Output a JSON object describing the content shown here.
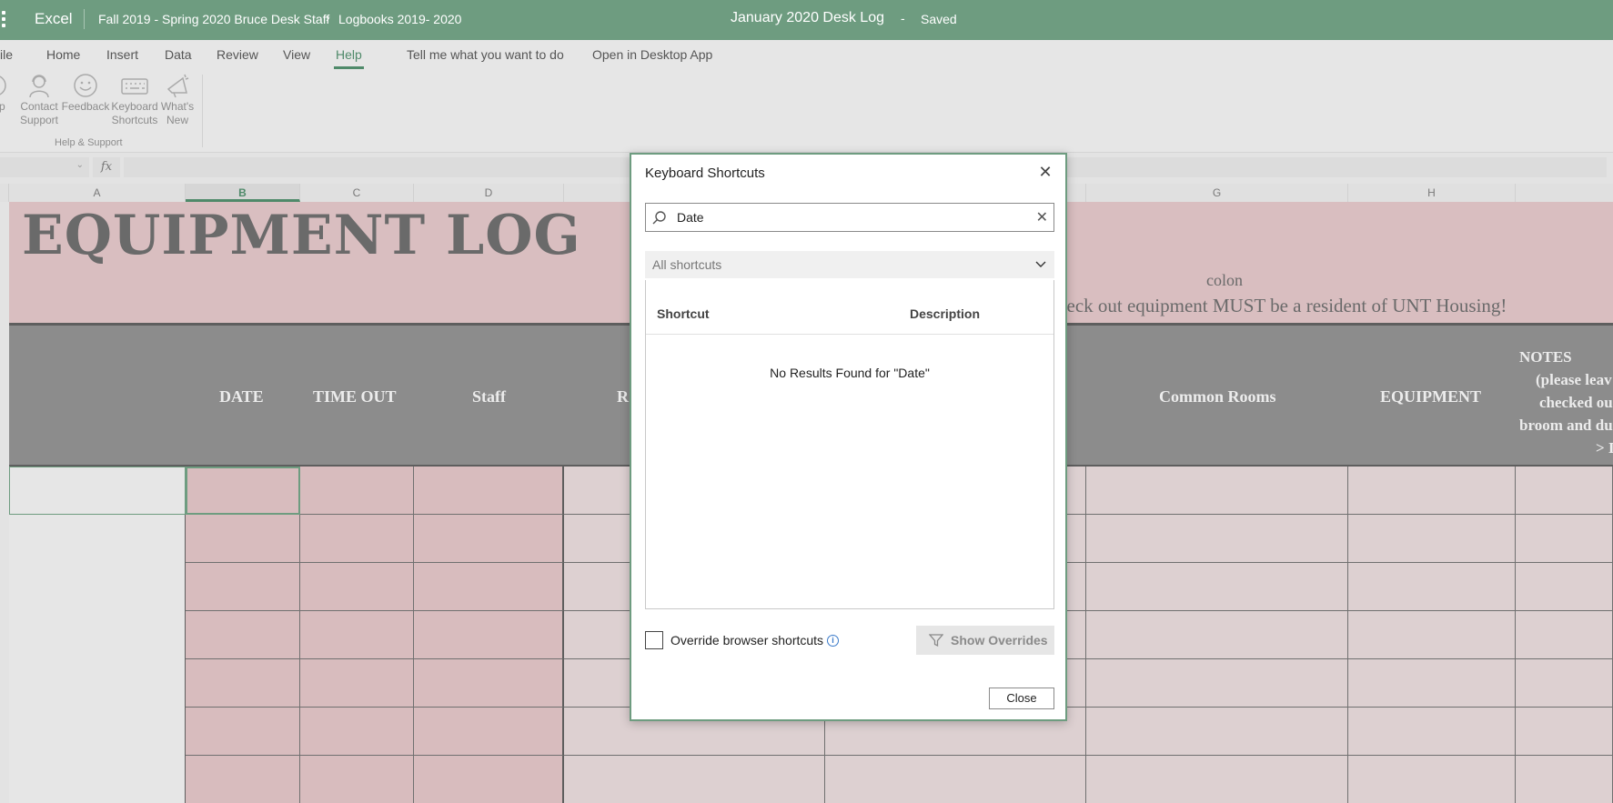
{
  "titlebar": {
    "app_name": "Excel",
    "breadcrumb_folder": "Fall 2019 - Spring 2020 Bruce Desk Staff",
    "breadcrumb_separator": "›",
    "breadcrumb_subfolder": "Logbooks 2019- 2020",
    "document_name": "January 2020 Desk Log",
    "status_separator": "-",
    "status": "Saved",
    "color": "#6e9c80"
  },
  "menu": {
    "tabs": [
      "ile",
      "Home",
      "Insert",
      "Data",
      "Review",
      "View",
      "Help"
    ],
    "active_tab": "Help",
    "tell_me": "Tell me what you want to do",
    "open_desktop": "Open in Desktop App"
  },
  "ribbon": {
    "help_partial": "lp",
    "contact_support": [
      "Contact",
      "Support"
    ],
    "feedback": "Feedback",
    "keyboard_shortcuts": [
      "Keyboard",
      "Shortcuts"
    ],
    "whats_new": [
      "What's",
      "New"
    ],
    "group_label": "Help & Support"
  },
  "formula_bar": {
    "fx": "fx",
    "value": ""
  },
  "columns": [
    "A",
    "B",
    "C",
    "D",
    "G",
    "H"
  ],
  "selected_column": "B",
  "sheet": {
    "banner_title": "EQUIPMENT LOG",
    "banner_colon": "colon",
    "banner_notice": "heck out equipment MUST be a resident of UNT Housing!",
    "headers": {
      "date": "DATE",
      "time_out": "TIME OUT",
      "staff": "Staff",
      "r_partial": "R",
      "common_rooms": "Common Rooms",
      "equipment": "EQUIPMENT",
      "notes_lines": [
        "NOTES",
        "(please leav",
        "checked ou",
        "broom and du",
        "> I"
      ]
    },
    "banner_color": "#d9bec0",
    "header_color": "#8c8c8c"
  },
  "dialog": {
    "title": "Keyboard Shortcuts",
    "search_value": "Date",
    "filter_label": "All shortcuts",
    "col_shortcut": "Shortcut",
    "col_description": "Description",
    "empty_message": "No Results Found for \"Date\"",
    "override_label": "Override browser shortcuts",
    "override_checked": false,
    "show_overrides": "Show Overrides",
    "close_label": "Close",
    "accent": "#6e9c80"
  }
}
